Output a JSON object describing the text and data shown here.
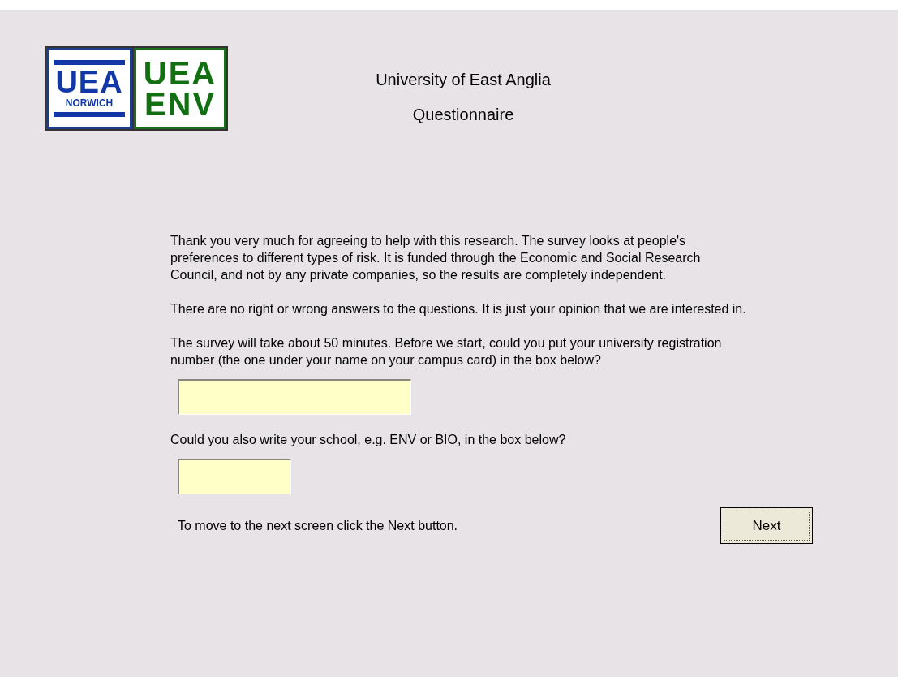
{
  "logo": {
    "left": {
      "top": "UEA",
      "bottom": "NORWICH"
    },
    "right": {
      "top": "UEA",
      "bottom": "ENV"
    }
  },
  "header": {
    "title": "University of East Anglia",
    "subtitle": "Questionnaire"
  },
  "paragraphs": [
    "Thank you very much for agreeing to help with this research. The survey looks at people's preferences to different types of risk. It is funded through the Economic and Social Research Council, and not by any private companies, so the results are completely independent.",
    "There are no right or wrong answers to the questions. It is just your opinion that we are interested in.",
    "The survey will take about 50 minutes. Before we start, could you put your university registration number (the one under your name on your campus card) in the box below?"
  ],
  "school_prompt": "Could you also write your school, e.g. ENV or BIO, in the box below?",
  "footer": {
    "hint": "To move to the next screen click the Next button.",
    "button": "Next"
  }
}
